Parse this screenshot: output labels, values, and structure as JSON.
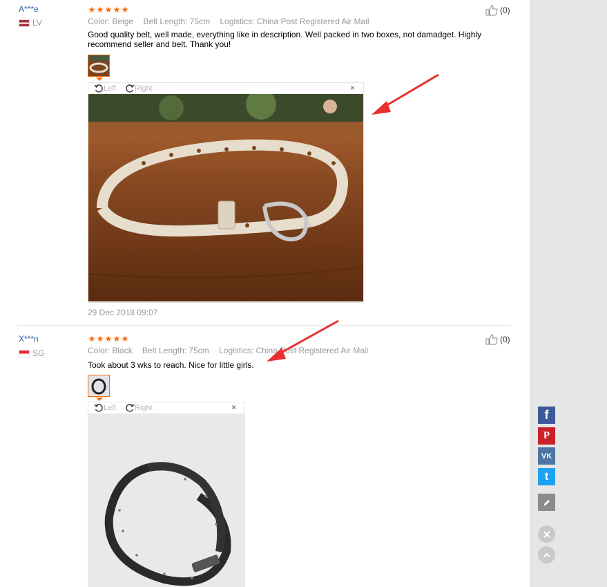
{
  "reviews": [
    {
      "buyer": "A***e",
      "country": "LV",
      "rating": 5,
      "color": "Color: Beige",
      "belt_length": "Belt Length: 75cm",
      "logistics": "Logistics: China Post Registered Air Mail",
      "text": "Good quality belt, well made, everything like in description. Well packed in two boxes, not damadget. Highly recommend seller and belt. Thank you!",
      "helpful": "(0)",
      "rotate_left": "Left",
      "rotate_right": "Right",
      "close": "×",
      "date": "29 Dec 2018 09:07"
    },
    {
      "buyer": "X***n",
      "country": "SG",
      "rating": 5,
      "color": "Color: Black",
      "belt_length": "Belt Length: 75cm",
      "logistics": "Logistics: China Post Registered Air Mail",
      "text": "Took about 3 wks to reach. Nice for little girls.",
      "helpful": "(0)",
      "rotate_left": "Left",
      "rotate_right": "Right",
      "close": "×"
    }
  ],
  "share": {
    "facebook_glyph": "f",
    "pinterest_glyph": "P",
    "vk_glyph": "VK",
    "twitter_glyph": "t"
  },
  "colors": {
    "accent": "#ff6a00",
    "link": "#2a5da8",
    "annotation_arrow": "#e8302e",
    "facebook": "#3b5998",
    "pinterest": "#cb2027",
    "vk": "#4c75a3",
    "twitter": "#1da1f2"
  }
}
